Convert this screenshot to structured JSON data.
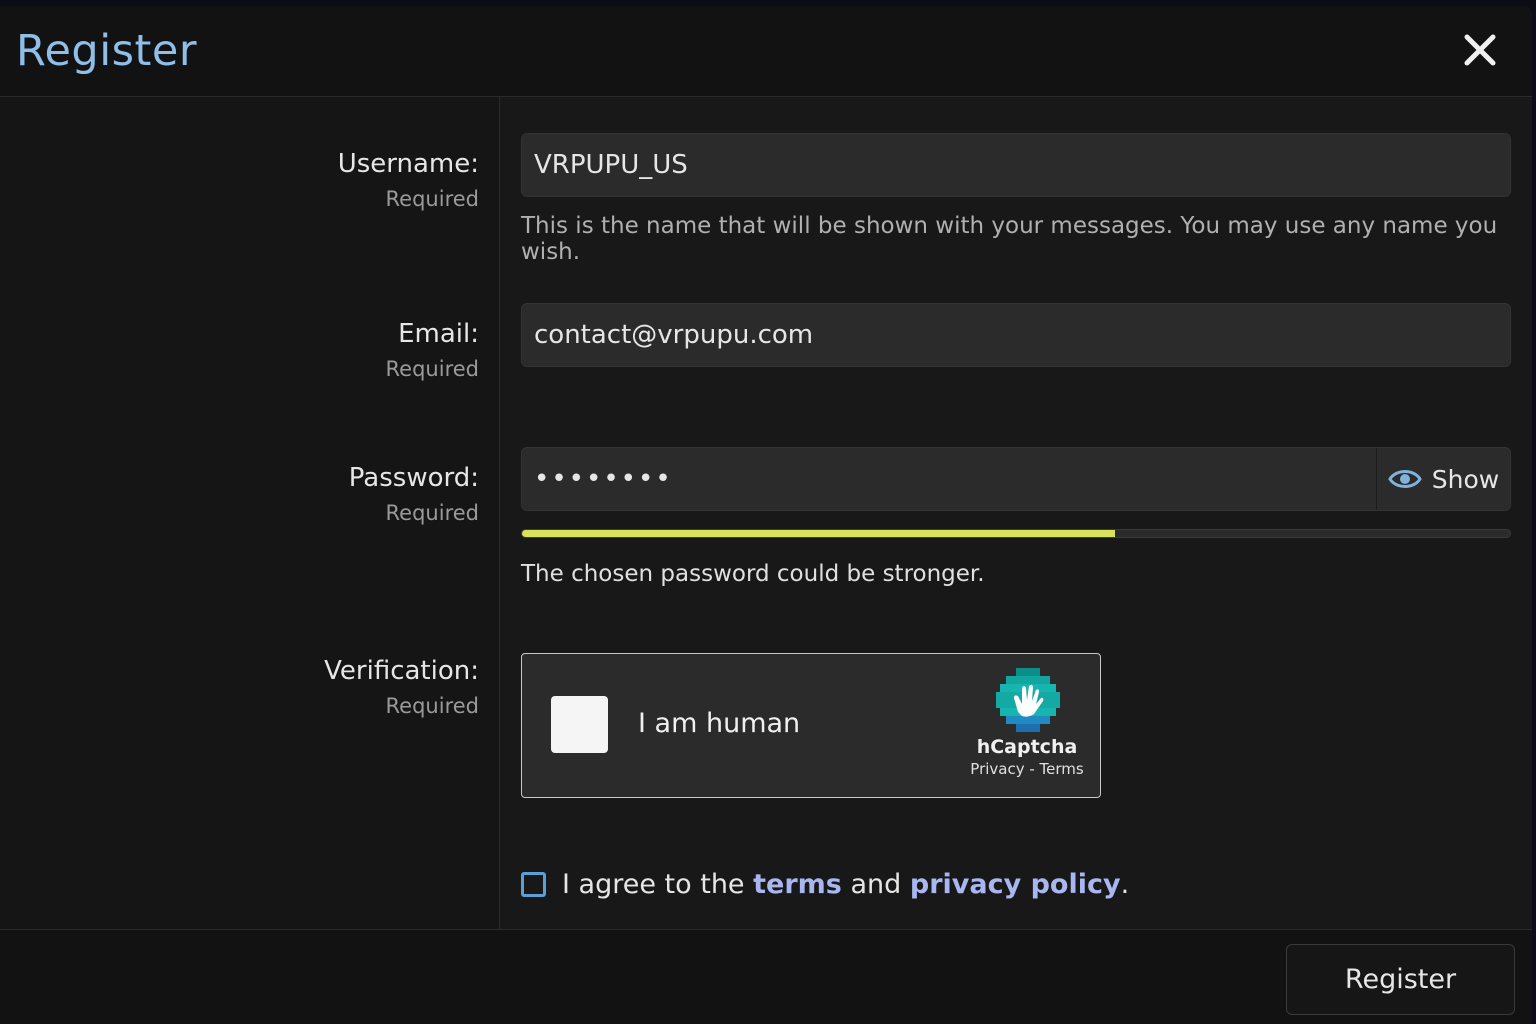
{
  "dialog": {
    "title": "Register",
    "close_icon": "close-icon"
  },
  "fields": {
    "username": {
      "label": "Username:",
      "required": "Required",
      "value": "VRPUPU_US",
      "hint": "This is the name that will be shown with your messages. You may use any name you wish."
    },
    "email": {
      "label": "Email:",
      "required": "Required",
      "value": "contact@vrpupu.com"
    },
    "password": {
      "label": "Password:",
      "required": "Required",
      "value": "••••••••",
      "show_label": "Show",
      "show_icon": "eye-icon",
      "strength_percent": 60,
      "strength_color": "#d8e25a",
      "strength_message": "The chosen password could be stronger."
    },
    "verification": {
      "label": "Verification:",
      "required": "Required",
      "captcha_text": "I am human",
      "brand": "hCaptcha",
      "links": "Privacy - Terms"
    }
  },
  "agreement": {
    "prefix": "I agree to the",
    "terms": "terms",
    "and": "and",
    "privacy": "privacy policy",
    "suffix": "."
  },
  "footer": {
    "register_label": "Register"
  },
  "colors": {
    "accent_title": "#8fbfe8",
    "link": "#a9b6f0"
  }
}
